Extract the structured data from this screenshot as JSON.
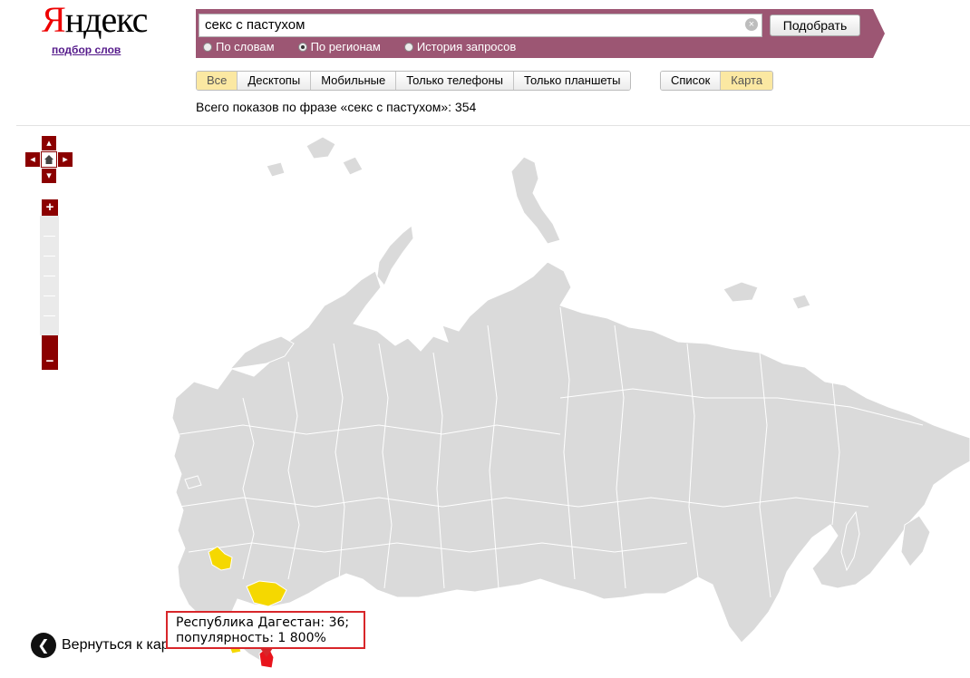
{
  "logo": {
    "part1": "Я",
    "part2": "ндекс"
  },
  "wordstat_link": "подбор слов",
  "search": {
    "value": "секс с пастухом",
    "submit": "Подобрать"
  },
  "modes": [
    {
      "label": "По словам",
      "selected": false
    },
    {
      "label": "По регионам",
      "selected": true
    },
    {
      "label": "История запросов",
      "selected": false
    }
  ],
  "device_tabs": [
    "Все",
    "Десктопы",
    "Мобильные",
    "Только телефоны",
    "Только планшеты"
  ],
  "device_tab_active": "Все",
  "view_tabs": [
    "Список",
    "Карта"
  ],
  "view_tab_active": "Карта",
  "total_line": "Всего показов по фразе «секс с пастухом»: 354",
  "map": {
    "back_link": "Вернуться к карте",
    "tooltip": {
      "line1": "Республика Дагестан: 36;",
      "line2": "популярность: 1 800%"
    },
    "colors": {
      "land": "#dadada",
      "highlight": "#f5d800",
      "active": "#e8141c"
    }
  },
  "icons": {
    "pan_up": "chevron-up-icon",
    "pan_down": "chevron-down-icon",
    "pan_left": "chevron-left-icon",
    "pan_right": "chevron-right-icon",
    "home": "home-icon",
    "zoom_in": "plus-icon",
    "zoom_out": "minus-icon",
    "back": "arrow-left-icon",
    "clear": "clear-icon"
  }
}
